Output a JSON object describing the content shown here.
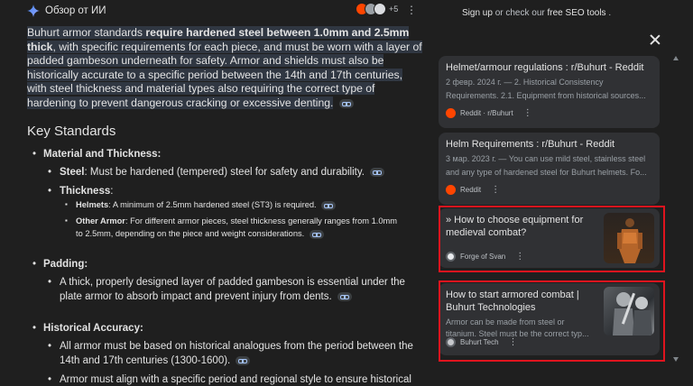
{
  "overview": {
    "title": "Обзор от ИИ",
    "sources_more": "+5",
    "intro_pre": "Buhurt armor standards ",
    "intro_bold": "require hardened steel between 1.0mm and 2.5mm thick",
    "intro_post": ", with specific requirements for each piece, and must be worn with a layer of padded gambeson underneath for safety. Armor and shields must also be historically accurate to a specific period between the 14th and 17th centuries, with steel thickness and material types also requiring the correct type of hardening to prevent dangerous cracking or excessive denting.",
    "heading": "Key Standards",
    "material": {
      "label": "Material and Thickness:",
      "steel_label": "Steel",
      "steel_text": ": Must be hardened (tempered) steel for safety and durability.",
      "thickness_label": "Thickness",
      "thickness_colon": ":",
      "helmets_label": "Helmets",
      "helmets_text": ": A minimum of 2.5mm hardened steel (ST3) is required.",
      "other_label": "Other Armor",
      "other_text_1": ": For different armor pieces, steel thickness generally ranges from 1.0mm",
      "other_text_2": "to 2.5mm, depending on the piece and weight considerations."
    },
    "padding": {
      "label": "Padding:",
      "text_1": "A thick, properly designed layer of padded gambeson is essential under the",
      "text_2": "plate armor to absorb impact and prevent injury from dents."
    },
    "historical": {
      "label": "Historical Accuracy:",
      "text_1": "All armor must be based on historical analogues from the period between the",
      "text_2": "14th and 17th centuries (1300-1600).",
      "text_3": "Armor must align with a specific period and regional style to ensure historical"
    }
  },
  "panel": {
    "seo_link_1": "Sign up",
    "seo_mid": " or check our ",
    "seo_link_2": "free SEO tools",
    "seo_tail": " .",
    "cards": [
      {
        "title": "Helmet/armour regulations : r/Buhurt - Reddit",
        "snippet_1": "2 февр. 2024 г. — 2. Historical Consistency",
        "snippet_2": "Requirements. 2.1. Equipment from historical sources...",
        "source": "Reddit · r/Buhurt",
        "favicon_color": "#ff4500"
      },
      {
        "title": "Helm Requirements : r/Buhurt - Reddit",
        "snippet_1": "3 мар. 2023 г. — You can use mild steel, stainless steel",
        "snippet_2": "and any type of hardened steel for Buhurt helmets. Fo...",
        "source": "Reddit",
        "favicon_color": "#ff4500"
      },
      {
        "title_1": "» How to choose equipment for",
        "title_2": "medieval combat?",
        "source": "Forge of Svan",
        "favicon_color": "#e8eaed"
      },
      {
        "title_1": "How to start armored combat |",
        "title_2": "Buhurt Technologies",
        "snippet_1": "Armor can be made from steel or",
        "snippet_2": "titanium. Steel must be the correct typ...",
        "source": "Buhurt Tech",
        "favicon_color": "#c6c8cc"
      }
    ],
    "highlight_color": "#e0141e"
  }
}
